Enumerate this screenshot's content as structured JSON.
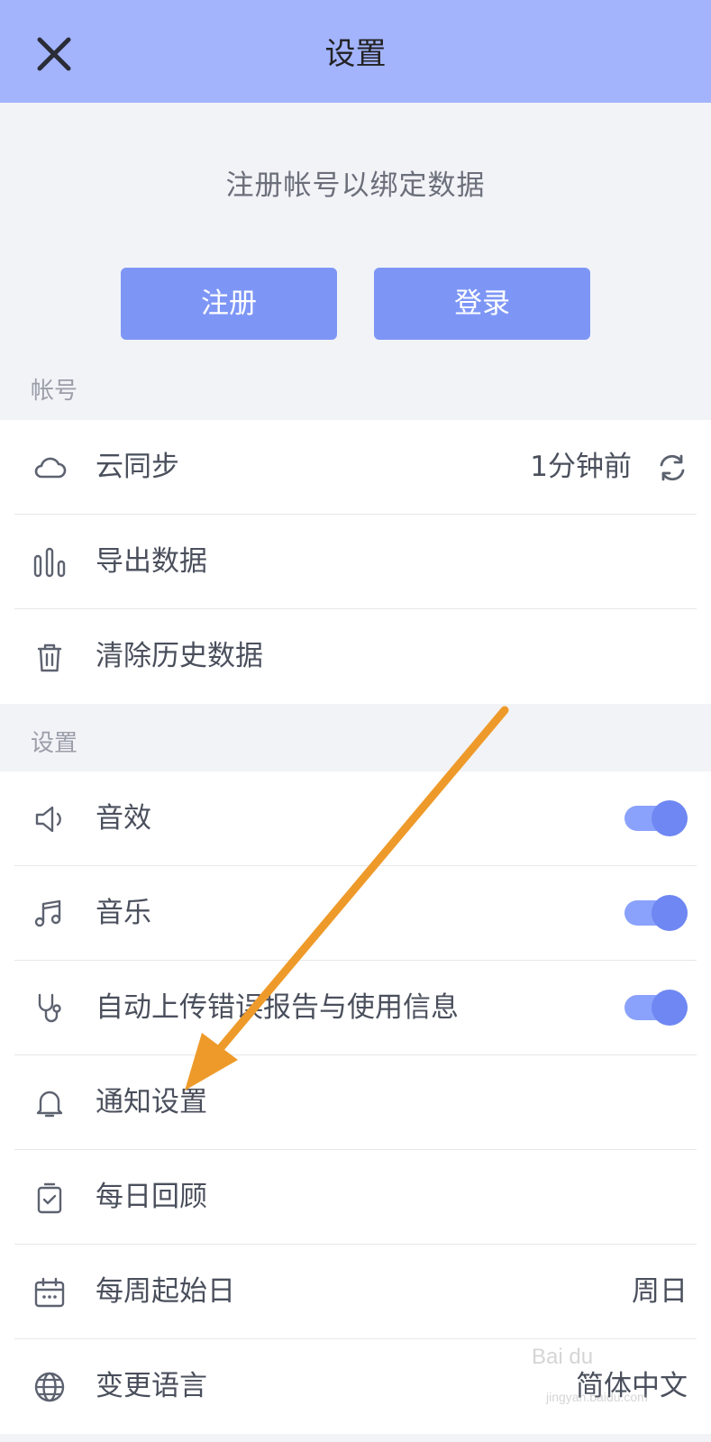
{
  "header": {
    "title": "设置"
  },
  "promo": {
    "text": "注册帐号以绑定数据",
    "register_label": "注册",
    "login_label": "登录"
  },
  "account": {
    "section_label": "帐号",
    "items": [
      {
        "label": "云同步",
        "value": "1分钟前",
        "icon": "cloud-icon"
      },
      {
        "label": "导出数据",
        "icon": "bar-chart-icon"
      },
      {
        "label": "清除历史数据",
        "icon": "trash-icon"
      }
    ]
  },
  "settings": {
    "section_label": "设置",
    "items": [
      {
        "label": "音效",
        "icon": "speaker-icon",
        "toggle": true
      },
      {
        "label": "音乐",
        "icon": "music-icon",
        "toggle": true
      },
      {
        "label": "自动上传错误报告与使用信息",
        "icon": "stethoscope-icon",
        "toggle": true
      },
      {
        "label": "通知设置",
        "icon": "bell-icon"
      },
      {
        "label": "每日回顾",
        "icon": "clipboard-check-icon"
      },
      {
        "label": "每周起始日",
        "value": "周日",
        "icon": "calendar-icon"
      },
      {
        "label": "变更语言",
        "value": "简体中文",
        "icon": "globe-icon"
      }
    ]
  },
  "watermark": {
    "brand": "Bai du",
    "site": "jingyan.baidu.com"
  },
  "colors": {
    "header_bg": "#a3b4fd",
    "button_bg": "#7d96f6",
    "toggle_on": "#6e87f2",
    "annotation_arrow": "#ee9a2a"
  }
}
